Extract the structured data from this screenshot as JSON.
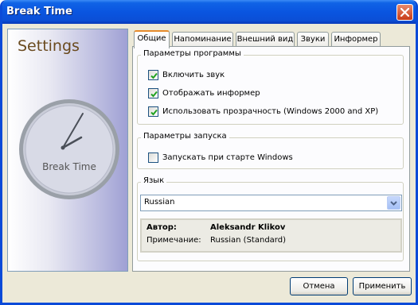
{
  "window": {
    "title": "Break Time"
  },
  "side": {
    "title": "Settings",
    "clock_label": "Break Time"
  },
  "tabs": [
    {
      "label": "Общие"
    },
    {
      "label": "Напоминание"
    },
    {
      "label": "Внешний вид"
    },
    {
      "label": "Звуки"
    },
    {
      "label": "Информер"
    }
  ],
  "program_group": {
    "title": "Параметры программы",
    "options": [
      {
        "label": "Включить звук",
        "checked": true
      },
      {
        "label": "Отображать информер",
        "checked": true
      },
      {
        "label": "Использовать прозрачность (Windows 2000 and XP)",
        "checked": true
      }
    ]
  },
  "startup_group": {
    "title": "Параметры запуска",
    "options": [
      {
        "label": "Запускать при старте Windows",
        "checked": false
      }
    ]
  },
  "language_group": {
    "title": "Язык",
    "selected": "Russian",
    "author_key": "Автор:",
    "author_value": "Aleksandr Klikov",
    "note_key": "Примечание:",
    "note_value": "Russian (Standard)"
  },
  "buttons": {
    "cancel": "Отмена",
    "apply": "Применить"
  }
}
